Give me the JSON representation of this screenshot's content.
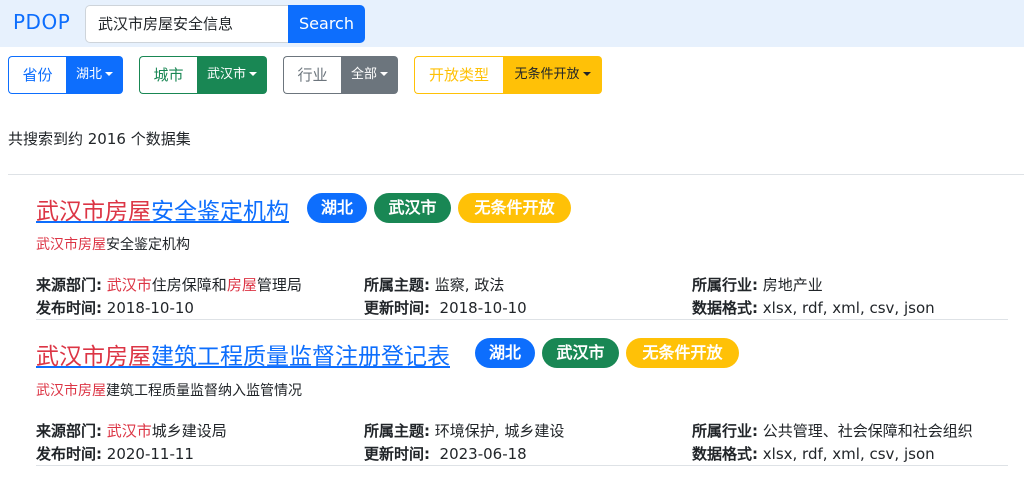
{
  "nav": {
    "brand": "PDOP",
    "search_value": "武汉市房屋安全信息",
    "search_button": "Search"
  },
  "filters": [
    {
      "label": "省份",
      "value": "湖北",
      "color": "#0d6efd"
    },
    {
      "label": "城市",
      "value": "武汉市",
      "color": "#198754"
    },
    {
      "label": "行业",
      "value": "全部",
      "color": "#6c757d"
    },
    {
      "label": "开放类型",
      "value": "无条件开放",
      "color": "#ffc107"
    }
  ],
  "result_count": "共搜索到约 2016 个数据集",
  "field_labels": {
    "source": "来源部门:",
    "topic": "所属主题:",
    "industry": "所属行业:",
    "published": "发布时间:",
    "updated": "更新时间:",
    "format": "数据格式:"
  },
  "results": [
    {
      "title_hl": "武汉市房屋",
      "title_rest": "安全鉴定机构",
      "badges": [
        "湖北",
        "武汉市",
        "无条件开放"
      ],
      "desc_hl": "武汉市房屋",
      "desc_rest": "安全鉴定机构",
      "source_hl1": "武汉市",
      "source_mid": "住房保障和",
      "source_hl2": "房屋",
      "source_end": "管理局",
      "topic": "监察, 政法",
      "industry": "房地产业",
      "published": "2018-10-10",
      "updated": "2018-10-10",
      "format": "xlsx, rdf, xml, csv, json"
    },
    {
      "title_hl": "武汉市房屋",
      "title_rest": "建筑工程质量监督注册登记表",
      "badges": [
        "湖北",
        "武汉市",
        "无条件开放"
      ],
      "desc_hl": "武汉市房屋",
      "desc_rest": "建筑工程质量监督纳入监管情况",
      "source_hl1": "武汉市",
      "source_mid": "城乡建设局",
      "source_hl2": "",
      "source_end": "",
      "topic": "环境保护, 城乡建设",
      "industry": "公共管理、社会保障和社会组织",
      "published": "2020-11-11",
      "updated": "2023-06-18",
      "format": "xlsx, rdf, xml, csv, json"
    }
  ]
}
